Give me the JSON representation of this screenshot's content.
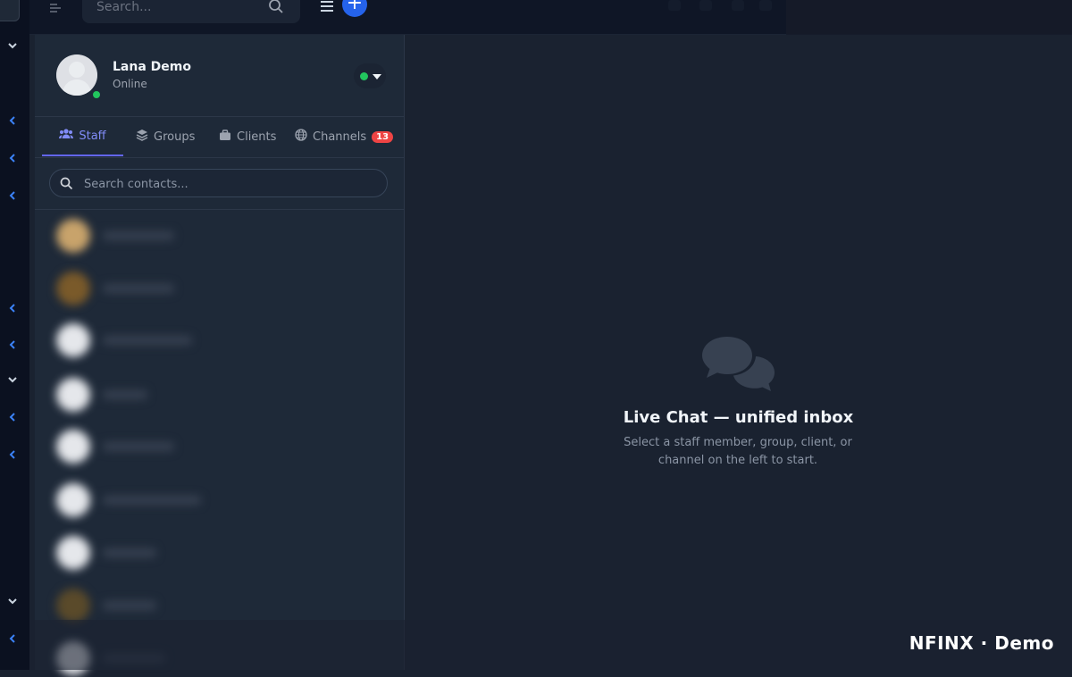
{
  "topbar": {
    "search_placeholder": "Search..."
  },
  "profile": {
    "name": "Lana Demo",
    "status": "Online"
  },
  "tabs": [
    {
      "label": "Staff",
      "icon": "users-icon",
      "active": true
    },
    {
      "label": "Groups",
      "icon": "layers-icon",
      "active": false
    },
    {
      "label": "Clients",
      "icon": "briefcase-icon",
      "active": false
    },
    {
      "label": "Channels",
      "icon": "globe-icon",
      "active": false,
      "badge": "13"
    }
  ],
  "contacts_search": {
    "placeholder": "Search contacts..."
  },
  "empty_state": {
    "title": "Live Chat — unified inbox",
    "subtitle": "Select a staff member, group, client, or channel on the left to start."
  },
  "brand": "NFINX · Demo",
  "colors": {
    "accent": "#6366f1",
    "online": "#22c55e",
    "badge": "#ef4444",
    "primary_button": "#2563eb"
  }
}
